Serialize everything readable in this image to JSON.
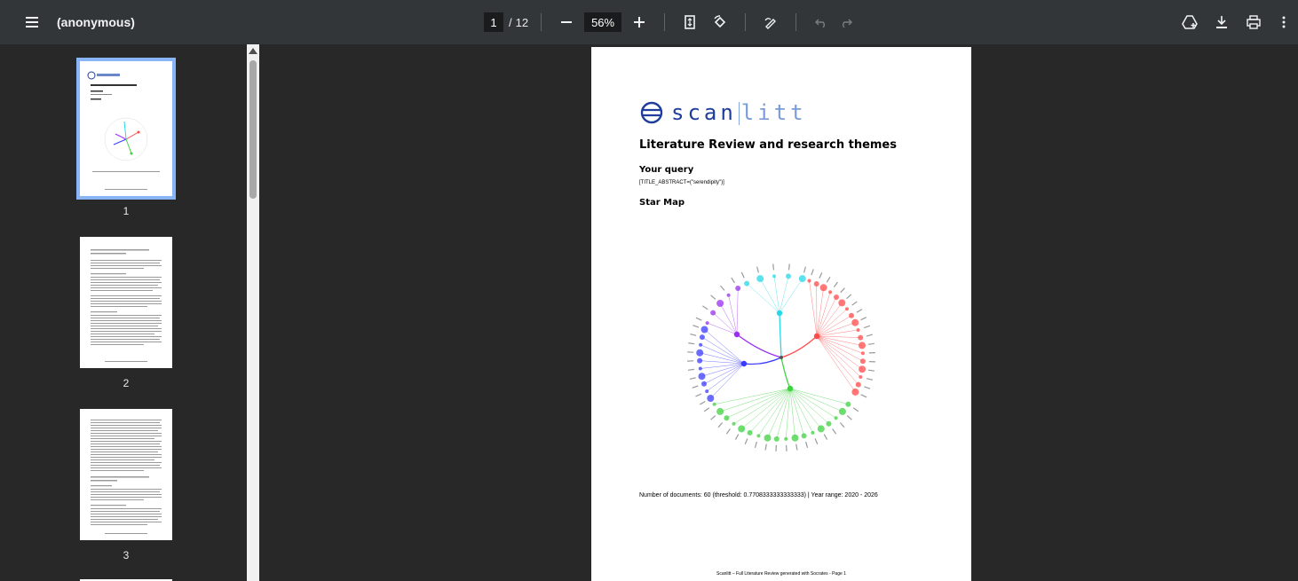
{
  "toolbar": {
    "title": "(anonymous)",
    "page_current": "1",
    "page_sep": "/",
    "page_total": "12",
    "zoom": "56%",
    "icons": {
      "menu": "hamburger-menu-icon",
      "zoom_out": "minus-icon",
      "zoom_in": "plus-icon",
      "fit": "fit-page-icon",
      "rotate": "rotate-icon",
      "annotate": "pen-icon",
      "undo": "undo-icon",
      "redo": "redo-icon",
      "drive": "save-to-drive-icon",
      "download": "download-icon",
      "print": "print-icon",
      "more": "more-vert-icon"
    }
  },
  "thumbnails": [
    {
      "num": "1",
      "selected": true
    },
    {
      "num": "2",
      "selected": false
    },
    {
      "num": "3",
      "selected": false
    }
  ],
  "page": {
    "logo_main": "scan",
    "logo_light": "litt",
    "title": "Literature Review and research themes",
    "query_heading": "Your query",
    "query_text": "[TITLE_ABSTRACT=(\"serendipity\")]",
    "starmap_heading": "Star Map",
    "stats": "Number of documents: 60 (threshold: 0.7708333333333333) | Year range: 2020 - 2026",
    "footer": "Scanlitt – Full Literature Review generated with Socrates - Page 1"
  },
  "colors": {
    "toolbar_bg": "#323639",
    "viewer_bg": "#282828",
    "selected_thumb": "#8ab4f8",
    "logo_blue": "#1f3d9c",
    "cluster_red": "#ff4a4a",
    "cluster_green": "#3fd13f",
    "cluster_blue": "#3b3bff",
    "cluster_purple": "#9b2ff0",
    "cluster_cyan": "#28d8e8"
  }
}
